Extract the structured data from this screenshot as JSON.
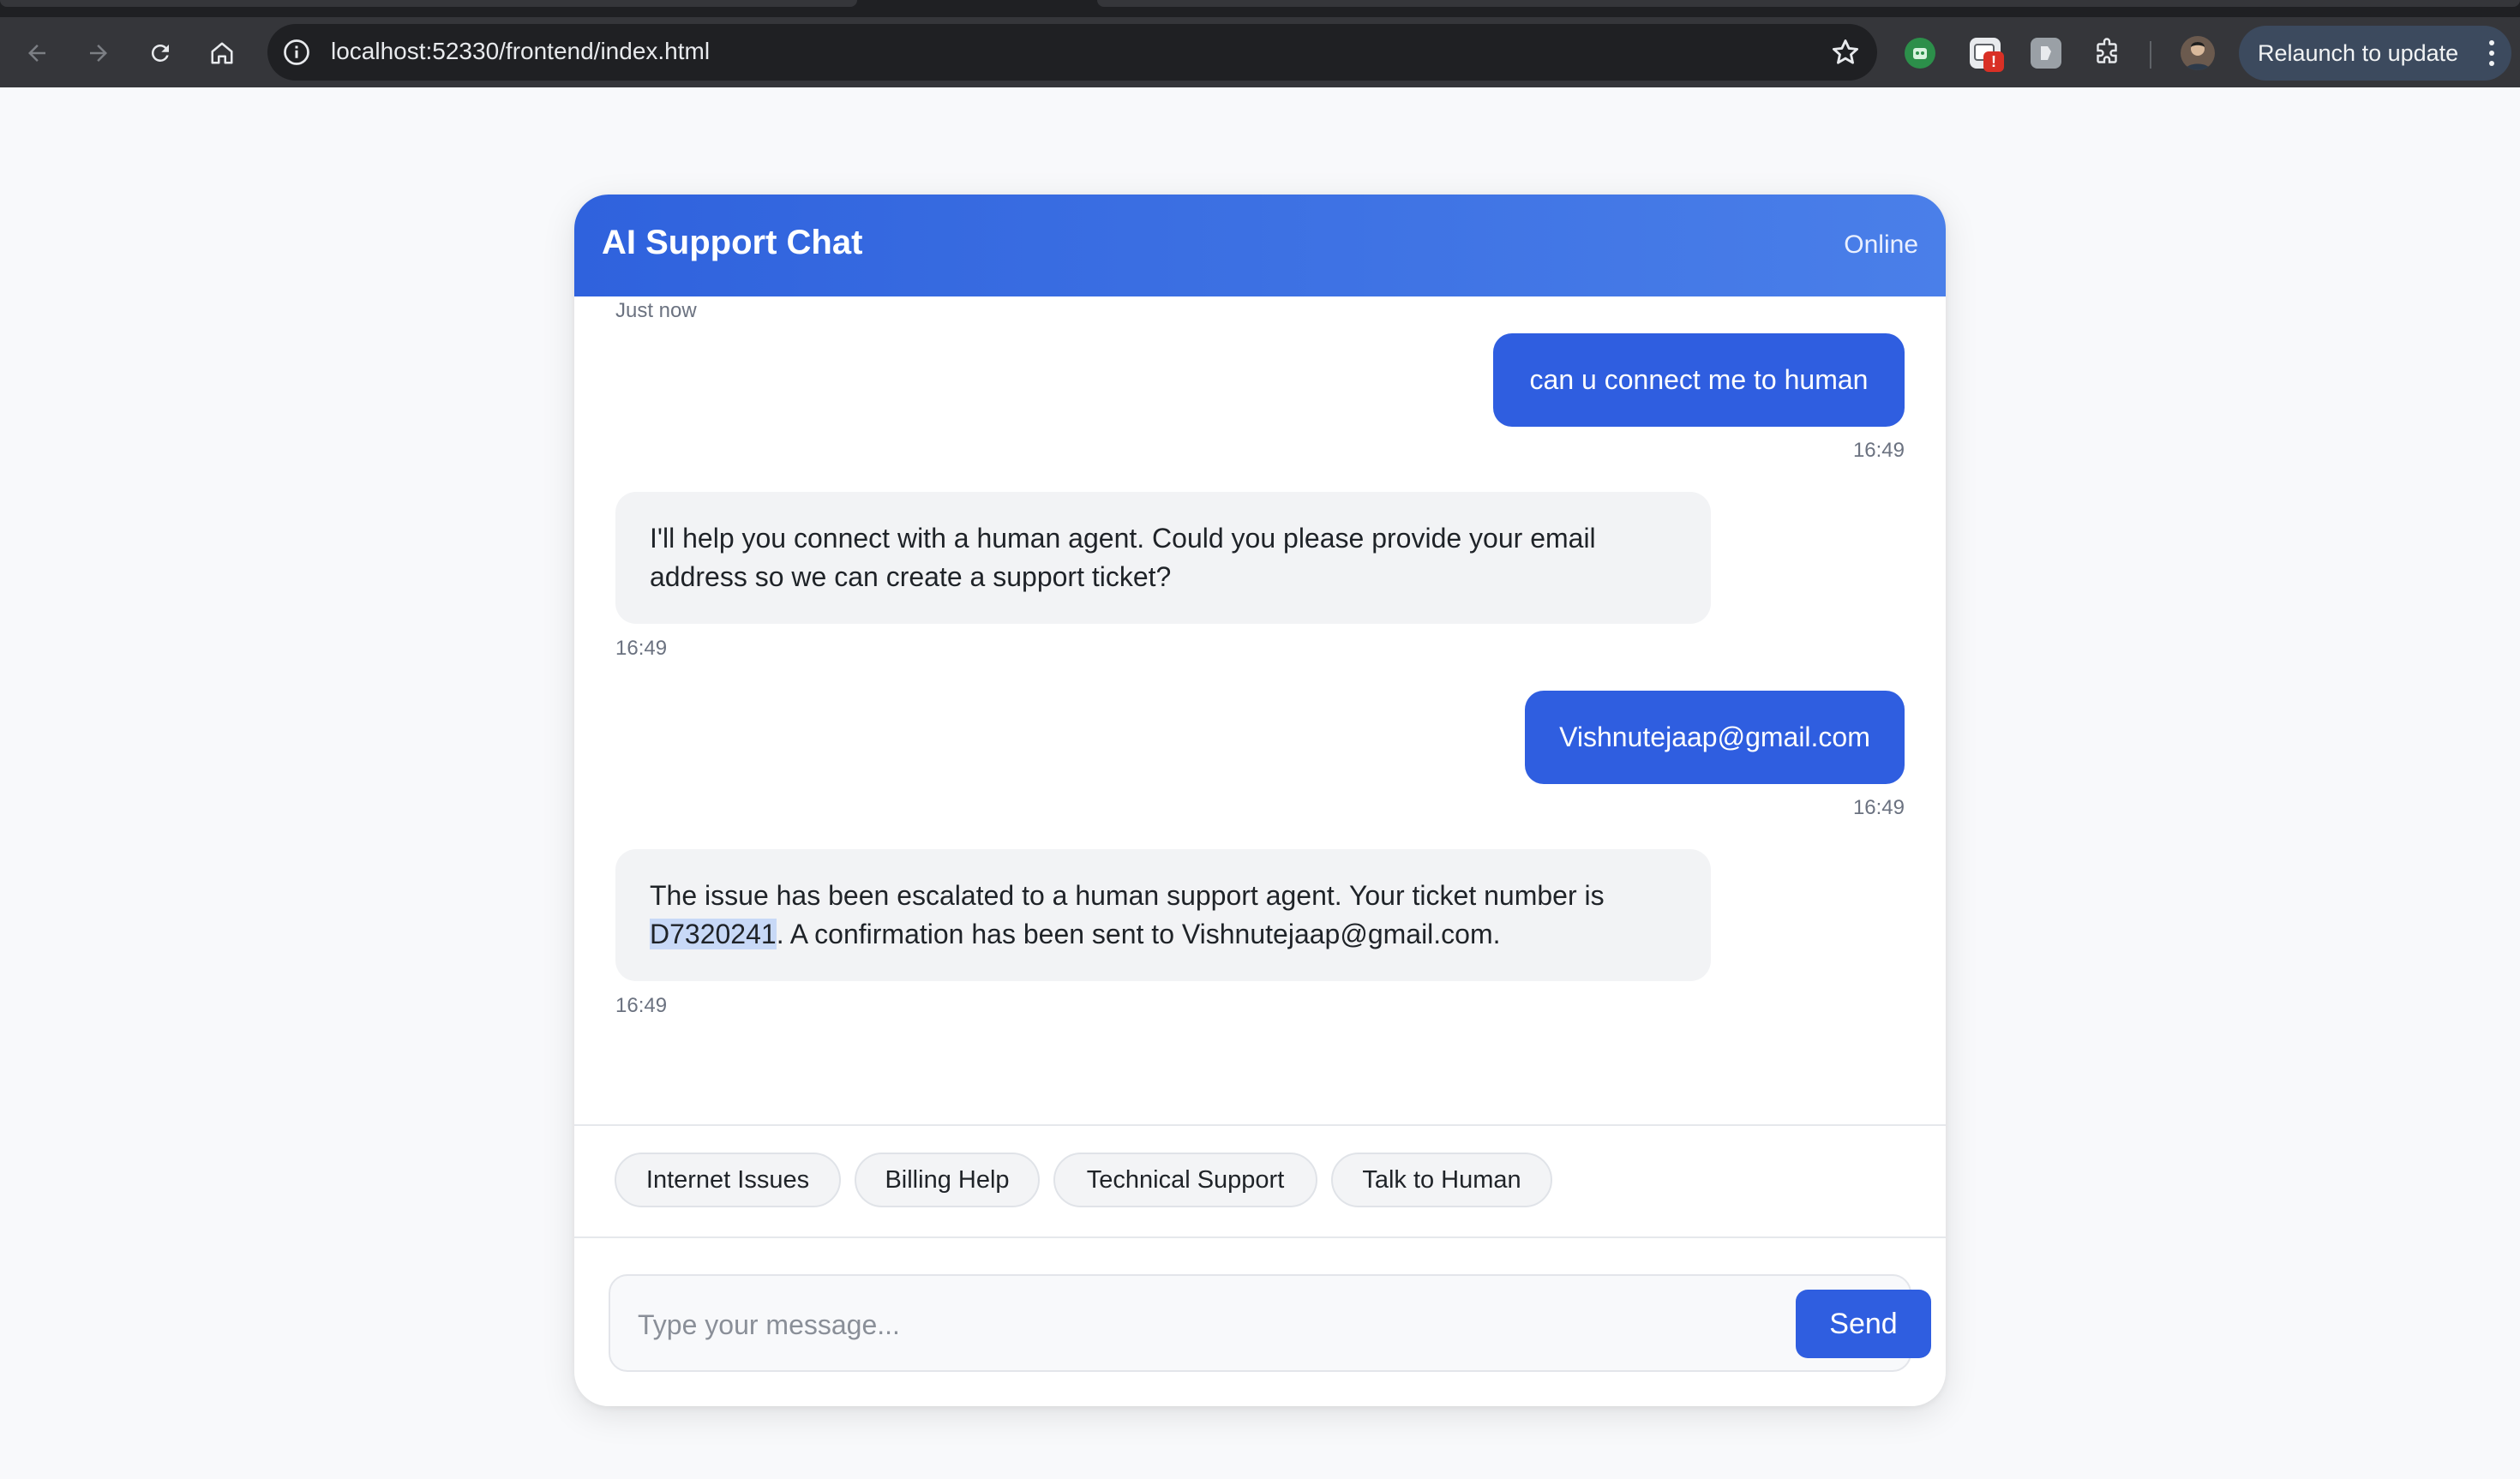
{
  "browser": {
    "url": "localhost:52330/frontend/index.html",
    "relaunch_label": "Relaunch to update",
    "extension_badge": "!"
  },
  "chat": {
    "title": "AI Support Chat",
    "status": "Online",
    "top_timestamp": "Just now",
    "messages": [
      {
        "sender": "user",
        "text": "can u connect me to human",
        "time": "16:49"
      },
      {
        "sender": "bot",
        "line1": "I'll help you connect with a human agent. Could you please provide your email",
        "line2": "address so we can create a support ticket?",
        "time": "16:49"
      },
      {
        "sender": "user",
        "text": "Vishnutejaap@gmail.com",
        "time": "16:49"
      },
      {
        "sender": "bot",
        "line1": "The issue has been escalated to a human support agent. Your ticket number is",
        "ticket": "D7320241",
        "line2_rest": ". A confirmation has been sent to Vishnutejaap@gmail.com.",
        "time": "16:49"
      }
    ],
    "quick_replies": [
      "Internet Issues",
      "Billing Help",
      "Technical Support",
      "Talk to Human"
    ],
    "input": {
      "placeholder": "Type your message...",
      "value": ""
    },
    "send_label": "Send"
  },
  "colors": {
    "header_gradient_start": "#2f62dd",
    "header_gradient_end": "#4a7fe9",
    "user_bubble": "#2f5ee0",
    "bot_bubble": "#f2f3f5",
    "send_button": "#2f5ee0"
  }
}
